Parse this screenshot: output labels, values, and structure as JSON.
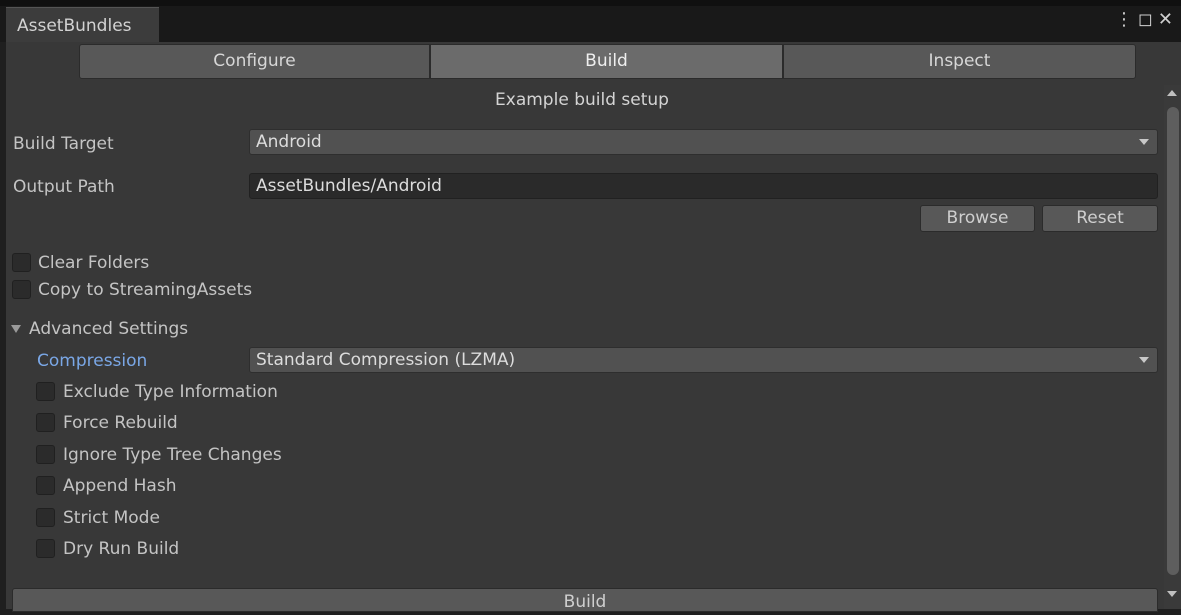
{
  "window": {
    "tab_title": "AssetBundles",
    "menu_icon": "vertical-ellipsis-icon",
    "maximize_icon": "maximize-icon",
    "close_icon": "close-icon"
  },
  "toolbar": {
    "tabs": [
      {
        "label": "Configure",
        "active": false
      },
      {
        "label": "Build",
        "active": true
      },
      {
        "label": "Inspect",
        "active": false
      }
    ]
  },
  "setup_title": "Example build setup",
  "build_target": {
    "label": "Build Target",
    "value": "Android"
  },
  "output_path": {
    "label": "Output Path",
    "value": "AssetBundles/Android"
  },
  "path_buttons": {
    "browse": "Browse",
    "reset": "Reset"
  },
  "options": [
    {
      "label": "Clear Folders",
      "checked": false
    },
    {
      "label": "Copy to StreamingAssets",
      "checked": false
    }
  ],
  "advanced": {
    "label": "Advanced Settings",
    "expanded": true,
    "compression": {
      "label": "Compression",
      "value": "Standard Compression (LZMA)"
    },
    "options": [
      {
        "label": "Exclude Type Information",
        "checked": false
      },
      {
        "label": "Force Rebuild",
        "checked": false
      },
      {
        "label": "Ignore Type Tree Changes",
        "checked": false
      },
      {
        "label": "Append Hash",
        "checked": false
      },
      {
        "label": "Strict Mode",
        "checked": false
      },
      {
        "label": "Dry Run Build",
        "checked": false
      }
    ]
  },
  "build_button": "Build",
  "colors": {
    "panel_bg": "#383838",
    "accent_label": "#7aa7e6"
  }
}
